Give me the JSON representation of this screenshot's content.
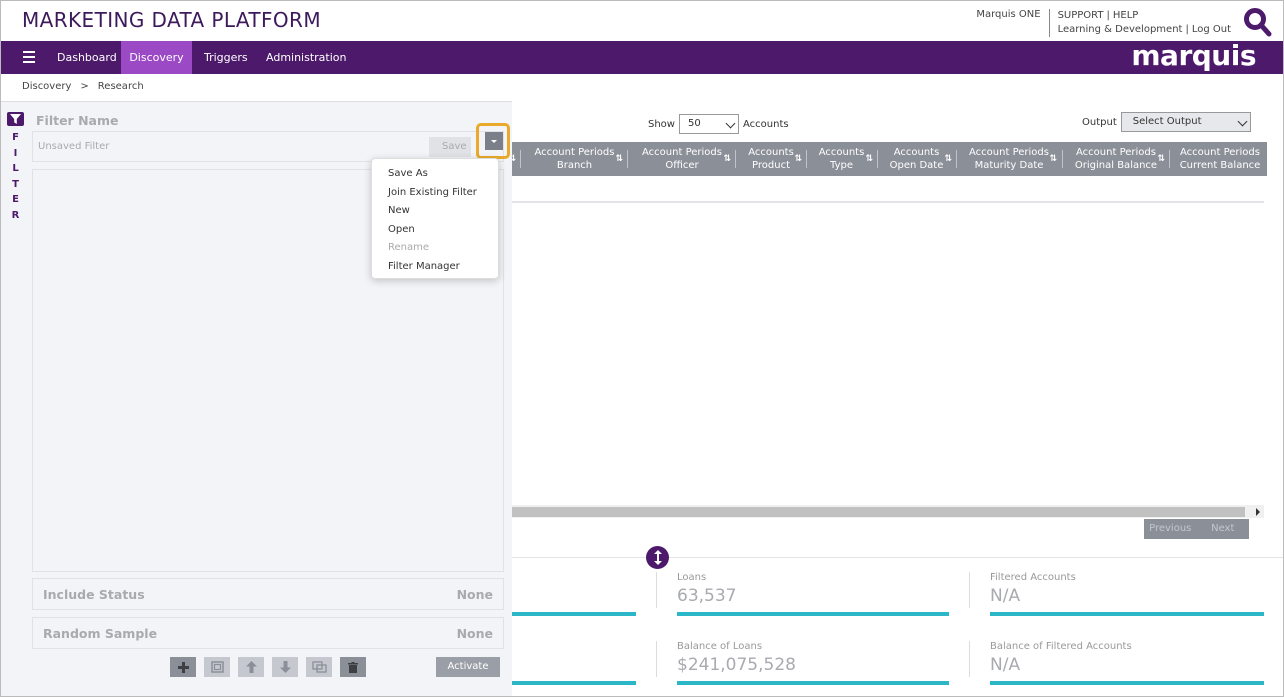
{
  "header": {
    "app_title": "MARKETING DATA PLATFORM",
    "user_link": "Marquis ONE",
    "support": "SUPPORT",
    "help": "HELP",
    "learning": "Learning & Development",
    "logout": "Log Out",
    "sep": "|",
    "brand": "marquis"
  },
  "nav": {
    "items": [
      {
        "label": "Dashboard"
      },
      {
        "label": "Discovery"
      },
      {
        "label": "Triggers"
      },
      {
        "label": "Administration"
      }
    ],
    "active": "Discovery"
  },
  "breadcrumb": {
    "root": "Discovery",
    "sep": ">",
    "current": "Research"
  },
  "filter_panel": {
    "tab_letters": "F\nI\nL\nT\nE\nR",
    "filter_name_label": "Filter Name",
    "filter_name_value": "Unsaved Filter",
    "save_label": "Save",
    "include_status_label": "Include Status",
    "include_status_value": "None",
    "random_sample_label": "Random Sample",
    "random_sample_value": "None",
    "activate_label": "Activate",
    "toolbar_icons": [
      "plus-icon",
      "group-icon",
      "arrow-up-icon",
      "arrow-down-icon",
      "ungroup-icon",
      "trash-icon"
    ]
  },
  "dropdown_menu": {
    "items": [
      {
        "label": "Save As"
      },
      {
        "label": "Join Existing Filter"
      },
      {
        "label": "New"
      },
      {
        "label": "Open"
      },
      {
        "label": "Rename",
        "disabled": true
      },
      {
        "label": "Filter Manager"
      }
    ]
  },
  "grid": {
    "show_label": "Show",
    "show_value": "50",
    "accounts_label": "Accounts",
    "output_label": "Output",
    "output_value": "Select Output",
    "columns": [
      {
        "l1": "Account Periods",
        "l2": "Branch"
      },
      {
        "l1": "Account Periods",
        "l2": "Officer"
      },
      {
        "l1": "Accounts",
        "l2": "Product"
      },
      {
        "l1": "Accounts",
        "l2": "Type"
      },
      {
        "l1": "Accounts",
        "l2": "Open Date"
      },
      {
        "l1": "Account Periods",
        "l2": "Maturity Date"
      },
      {
        "l1": "Account Periods",
        "l2": "Original Balance"
      },
      {
        "l1": "Account Periods",
        "l2": "Current Balance"
      }
    ],
    "sort_glyph": "⇅",
    "previous_label": "Previous",
    "next_label": "Next"
  },
  "summary": {
    "stats": [
      {
        "label": "Loans",
        "value": "63,537"
      },
      {
        "label": "Filtered Accounts",
        "value": "N/A"
      },
      {
        "label": "Balance of Loans",
        "value": "$241,075,528"
      },
      {
        "label": "Balance of Filtered Accounts",
        "value": "N/A"
      }
    ]
  },
  "colors": {
    "brand_purple": "#4d1a6b",
    "active_tab": "#9b49c5",
    "highlight": "#e9a92b",
    "stat_bar": "#2bb7c8"
  }
}
